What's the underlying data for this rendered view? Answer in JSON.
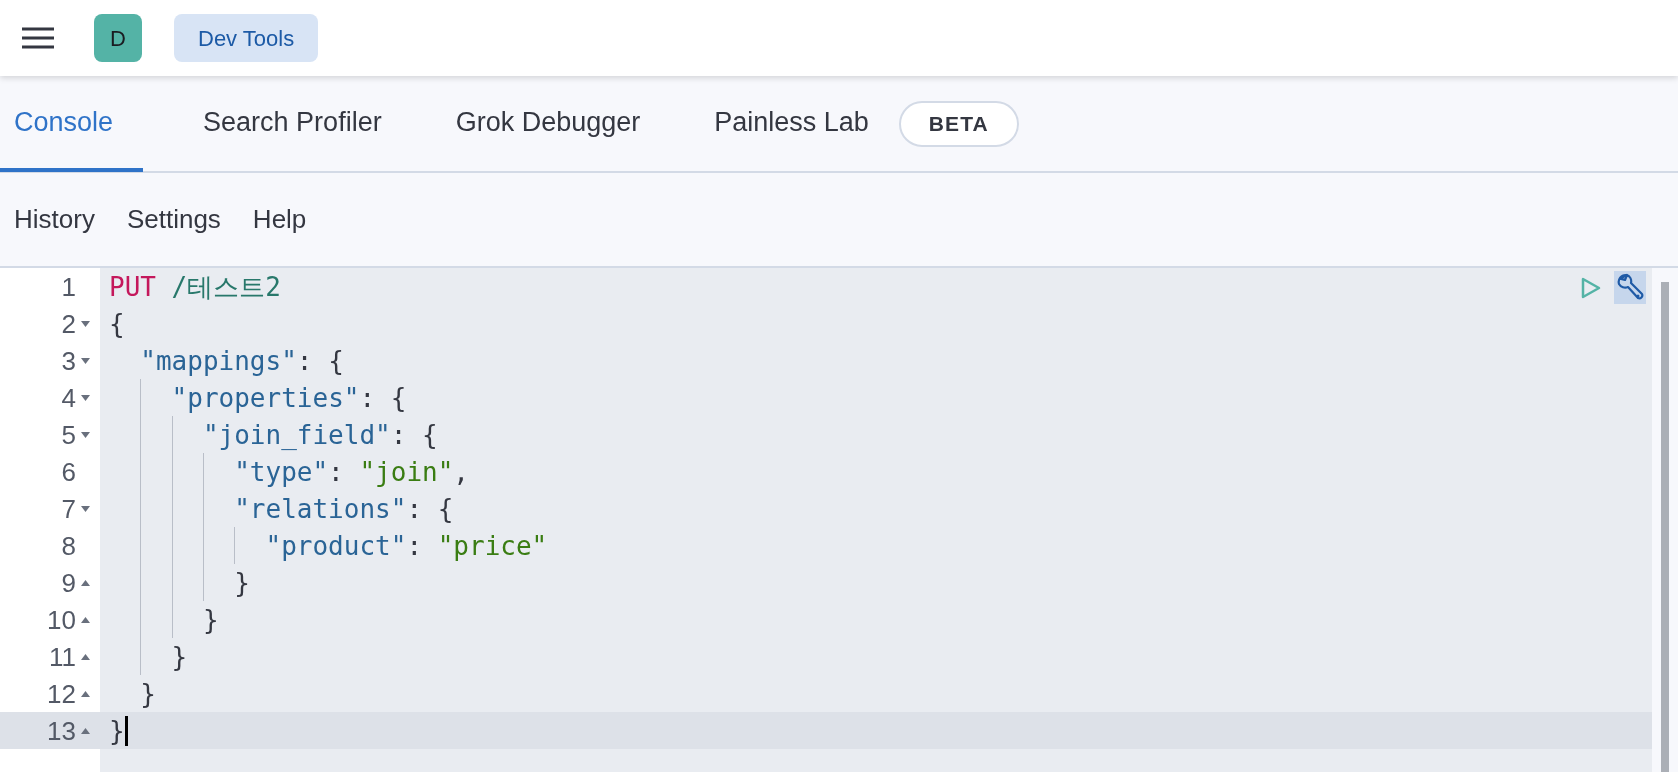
{
  "header": {
    "avatar": "D",
    "breadcrumb": "Dev Tools"
  },
  "tabs": [
    {
      "label": "Console",
      "selected": true
    },
    {
      "label": "Search Profiler",
      "selected": false
    },
    {
      "label": "Grok Debugger",
      "selected": false
    },
    {
      "label": "Painless Lab",
      "selected": false,
      "badge": "BETA"
    }
  ],
  "toolbar": [
    "History",
    "Settings",
    "Help"
  ],
  "editor": {
    "lines": [
      {
        "number": "1",
        "active": false,
        "kind": "plain",
        "tokens": [
          {
            "kind": "method",
            "text": "PUT"
          },
          {
            "kind": "url",
            "text": " /테스트2"
          }
        ]
      },
      {
        "number": "2",
        "active": false,
        "kind": "opener",
        "tokens": [
          {
            "kind": "punct",
            "text": "{"
          }
        ]
      },
      {
        "number": "3",
        "active": false,
        "kind": "opener",
        "tokens": [
          {
            "kind": "key",
            "text": "  \"mappings\""
          },
          {
            "kind": "punct",
            "text": ": {"
          }
        ]
      },
      {
        "number": "4",
        "active": false,
        "kind": "opener",
        "tokens": [
          {
            "kind": "key",
            "text": "    \"properties\""
          },
          {
            "kind": "punct",
            "text": ": {"
          }
        ]
      },
      {
        "number": "5",
        "active": false,
        "kind": "opener",
        "tokens": [
          {
            "kind": "key",
            "text": "      \"join_field\""
          },
          {
            "kind": "punct",
            "text": ": {"
          }
        ]
      },
      {
        "number": "6",
        "active": false,
        "kind": "plain",
        "tokens": [
          {
            "kind": "key",
            "text": "        \"type\""
          },
          {
            "kind": "punct",
            "text": ": "
          },
          {
            "kind": "string",
            "text": "\"join\""
          },
          {
            "kind": "punct",
            "text": ","
          }
        ]
      },
      {
        "number": "7",
        "active": false,
        "kind": "opener",
        "tokens": [
          {
            "kind": "key",
            "text": "        \"relations\""
          },
          {
            "kind": "punct",
            "text": ": {"
          }
        ]
      },
      {
        "number": "8",
        "active": false,
        "kind": "plain",
        "tokens": [
          {
            "kind": "key",
            "text": "          \"product\""
          },
          {
            "kind": "punct",
            "text": ": "
          },
          {
            "kind": "string",
            "text": "\"price\""
          }
        ]
      },
      {
        "number": "9",
        "active": false,
        "kind": "closer",
        "tokens": [
          {
            "kind": "punct",
            "text": "        }"
          }
        ]
      },
      {
        "number": "10",
        "active": false,
        "kind": "closer",
        "tokens": [
          {
            "kind": "punct",
            "text": "      }"
          }
        ]
      },
      {
        "number": "11",
        "active": false,
        "kind": "closer",
        "tokens": [
          {
            "kind": "punct",
            "text": "    }"
          }
        ]
      },
      {
        "number": "12",
        "active": false,
        "kind": "closer",
        "tokens": [
          {
            "kind": "punct",
            "text": "  }"
          }
        ]
      },
      {
        "number": "13",
        "active": true,
        "kind": "closer",
        "tokens": [
          {
            "kind": "punct",
            "text": "}"
          }
        ]
      }
    ]
  }
}
